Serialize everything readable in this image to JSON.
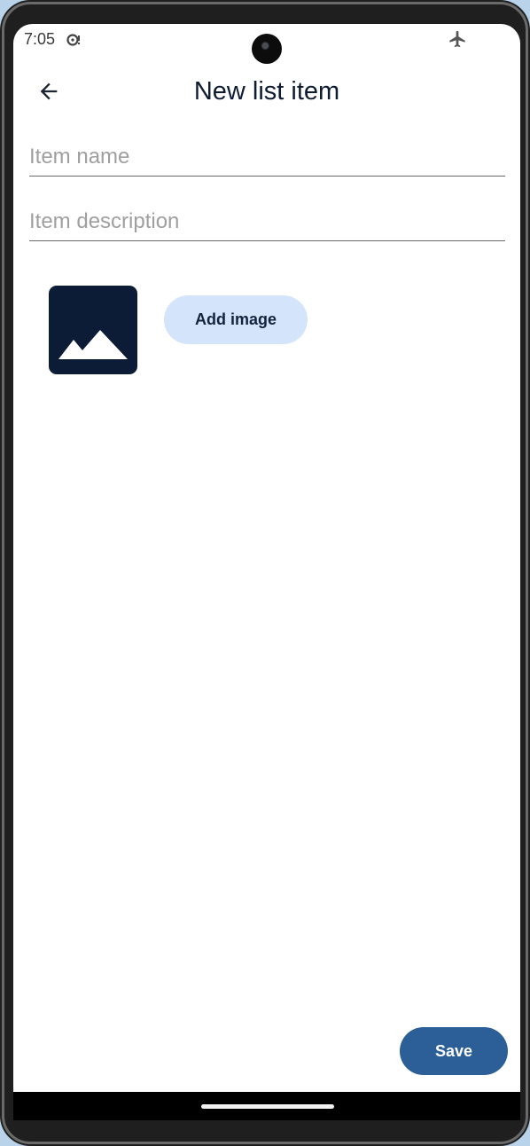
{
  "status_bar": {
    "time": "7:05",
    "icons": [
      "sync-icon",
      "airplane-mode-icon"
    ]
  },
  "app_bar": {
    "back_icon": "arrow-back-icon",
    "title": "New list item"
  },
  "form": {
    "item_name": {
      "value": "",
      "placeholder": "Item name"
    },
    "item_description": {
      "value": "",
      "placeholder": "Item description"
    },
    "image_placeholder_icon": "image-placeholder-icon",
    "add_image_label": "Add image"
  },
  "actions": {
    "save_label": "Save"
  },
  "colors": {
    "primary": "#2c5e98",
    "tonal_button": "#d4e4fa",
    "thumb_background": "#0c1c37",
    "title_text": "#0e1c33",
    "placeholder_text": "#9f9f9f"
  }
}
